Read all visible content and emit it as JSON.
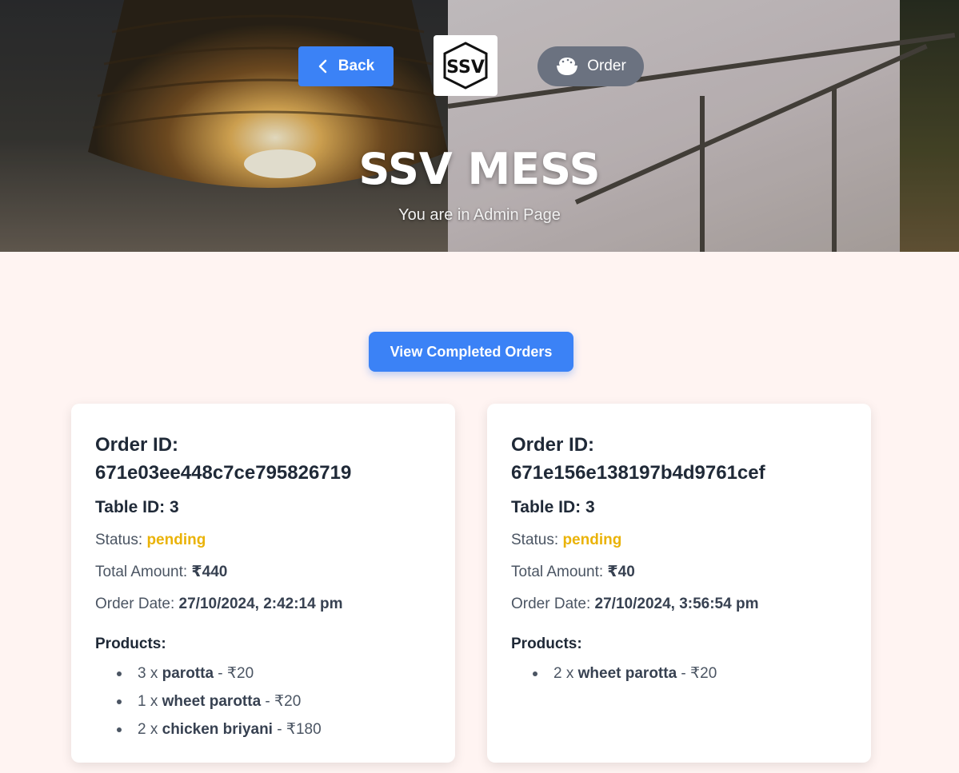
{
  "header": {
    "back_label": "Back",
    "order_label": "Order",
    "brand_title": "SSV MESS",
    "subtitle": "You are in Admin Page",
    "logo_text": "SSV"
  },
  "main": {
    "completed_button_label": "View Completed Orders"
  },
  "labels": {
    "order_id": "Order ID:",
    "status": "Status:",
    "total": "Total Amount:",
    "order_date": "Order Date:",
    "products": "Products:"
  },
  "orders": [
    {
      "id": "671e03ee448c7ce795826719",
      "table": "Table ID: 3",
      "status": "pending",
      "total": "₹440",
      "date": "27/10/2024, 2:42:14 pm",
      "products": [
        {
          "qty": "3 x ",
          "name": "parotta",
          "price": " - ₹20"
        },
        {
          "qty": "1 x ",
          "name": "wheet parotta",
          "price": " - ₹20"
        },
        {
          "qty": "2 x ",
          "name": "chicken briyani",
          "price": " - ₹180"
        }
      ]
    },
    {
      "id": "671e156e138197b4d9761cef",
      "table": "Table ID: 3",
      "status": "pending",
      "total": "₹40",
      "date": "27/10/2024, 3:56:54 pm",
      "products": [
        {
          "qty": "2 x ",
          "name": "wheet parotta",
          "price": " - ₹20"
        }
      ]
    }
  ],
  "colors": {
    "primary": "#3b82f6",
    "secondary": "#6b7280",
    "pending": "#eab308",
    "page_bg": "#fff4f2"
  },
  "icons": {
    "back": "chevron-left-icon",
    "order": "rice-bowl-icon"
  }
}
